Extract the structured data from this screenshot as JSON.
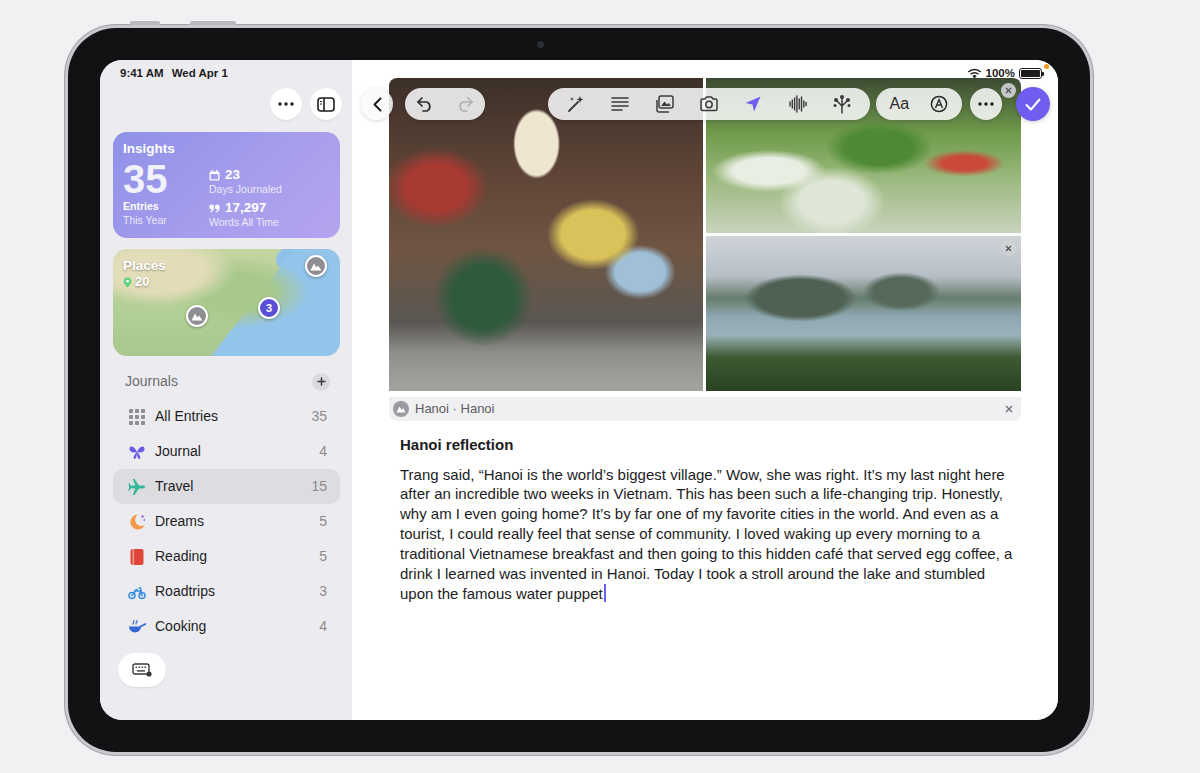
{
  "status_bar": {
    "time": "9:41 AM",
    "date": "Wed Apr 1",
    "battery": "100%",
    "battery_level": 1
  },
  "sidebar": {
    "insights": {
      "title": "Insights",
      "entries": "35",
      "entries_label": "Entries",
      "entries_sublabel": "This Year",
      "days": "23",
      "days_label": "Days Journaled",
      "words": "17,297",
      "words_label": "Words All Time"
    },
    "places": {
      "title": "Places",
      "count": "20",
      "pins": [
        {
          "kind": "photo"
        },
        {
          "kind": "photo"
        },
        {
          "kind": "cluster",
          "label": "3"
        }
      ]
    },
    "journals": {
      "title": "Journals",
      "items": [
        {
          "label": "All Entries",
          "count": "35",
          "selected": false,
          "color": "#8e8e93"
        },
        {
          "label": "Journal",
          "count": "4",
          "selected": false,
          "color": "#6a5ae6"
        },
        {
          "label": "Travel",
          "count": "15",
          "selected": true,
          "color": "#34b89b"
        },
        {
          "label": "Dreams",
          "count": "5",
          "selected": false,
          "color": "#f29a4a"
        },
        {
          "label": "Reading",
          "count": "5",
          "selected": false,
          "color": "#e0453a"
        },
        {
          "label": "Roadtrips",
          "count": "3",
          "selected": false,
          "color": "#3d8fe0"
        },
        {
          "label": "Cooking",
          "count": "4",
          "selected": false,
          "color": "#3367d6"
        }
      ]
    }
  },
  "toolbar": {
    "format_label": "Aa",
    "tools": [
      {
        "selected": false
      },
      {
        "selected": false
      },
      {
        "selected": false
      },
      {
        "selected": false
      },
      {
        "selected": true
      },
      {
        "selected": false
      },
      {
        "selected": false
      }
    ]
  },
  "entry": {
    "location": "Hanoi · Hanoi",
    "title": "Hanoi reflection",
    "body": "Trang said, “Hanoi is the world’s biggest village.” Wow, she was right. It’s my last night here after an incredible two weeks in Vietnam. This has been such a life-changing trip. Honestly, why am I even going home? It’s by far one of my favorite cities in the world. And even as a tourist, I could really feel that sense of community. I loved waking up every morning to a traditional Vietnamese breakfast and then going to this hidden café that served egg coffee, a drink I learned was invented in Hanoi. Today I took a stroll around the lake and stumbled upon the famous water puppet"
  }
}
